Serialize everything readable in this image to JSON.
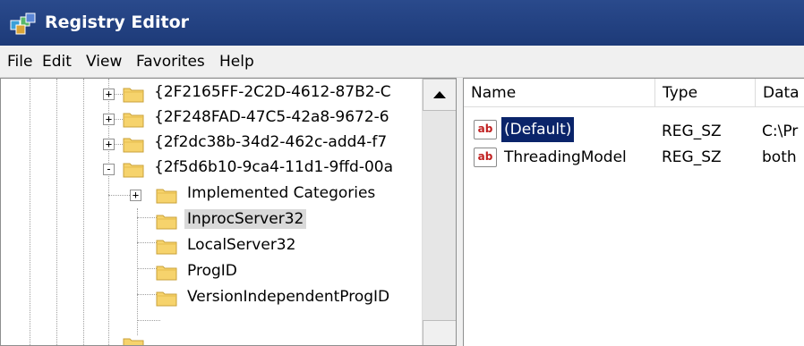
{
  "window": {
    "title": "Registry Editor",
    "icon": "registry-icon"
  },
  "menu": [
    "File",
    "Edit",
    "View",
    "Favorites",
    "Help"
  ],
  "tree": [
    {
      "label": "{2F2165FF-2C2D-4612-87B2-C",
      "expander": "+",
      "selected": false
    },
    {
      "label": "{2F248FAD-47C5-42a8-9672-6",
      "expander": "+",
      "selected": false
    },
    {
      "label": "{2f2dc38b-34d2-462c-add4-f7",
      "expander": "+",
      "selected": false
    },
    {
      "label": "{2f5d6b10-9ca4-11d1-9ffd-00a",
      "expander": "-",
      "selected": false
    },
    {
      "label": "Implemented Categories",
      "expander": "+",
      "selected": false
    },
    {
      "label": "InprocServer32",
      "expander": "",
      "selected": true
    },
    {
      "label": "LocalServer32",
      "expander": "",
      "selected": false
    },
    {
      "label": "ProgID",
      "expander": "",
      "selected": false
    },
    {
      "label": "VersionIndependentProgID",
      "expander": "",
      "selected": false
    }
  ],
  "columns": [
    "Name",
    "Type",
    "Data"
  ],
  "values": [
    {
      "name": "(Default)",
      "type": "REG_SZ",
      "data": "C:\\Pr",
      "selected": true,
      "icon": "string-value-icon"
    },
    {
      "name": "ThreadingModel",
      "type": "REG_SZ",
      "data": "both",
      "selected": false,
      "icon": "string-value-icon"
    }
  ]
}
